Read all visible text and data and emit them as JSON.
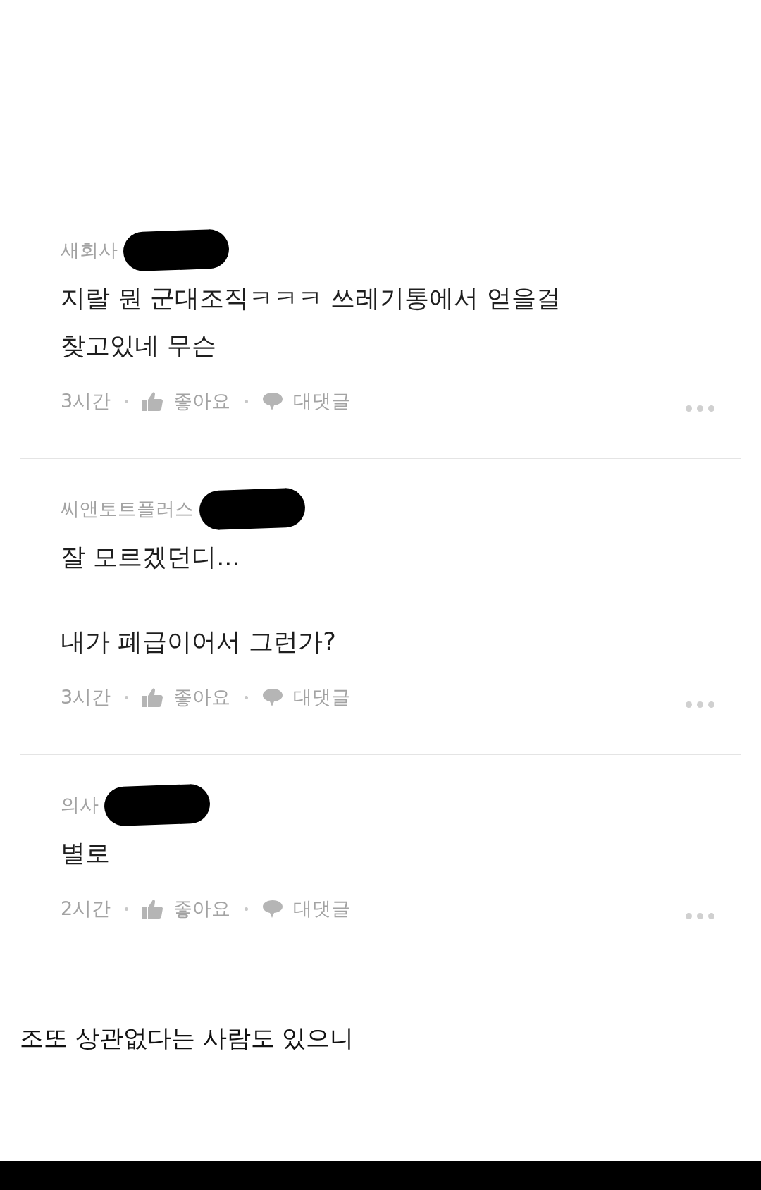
{
  "comments": [
    {
      "author": "새회사",
      "redacted": true,
      "paragraphs": [
        "지랄 뭔 군대조직ㅋㅋㅋ 쓰레기통에서 얻을걸 찾고있네 무슨"
      ],
      "time": "3시간",
      "like_label": "좋아요",
      "reply_label": "대댓글"
    },
    {
      "author": "씨앤토트플러스",
      "redacted": true,
      "paragraphs": [
        "잘 모르겠던디...",
        "내가 폐급이어서 그런가?"
      ],
      "time": "3시간",
      "like_label": "좋아요",
      "reply_label": "대댓글"
    },
    {
      "author": "의사",
      "redacted": true,
      "paragraphs": [
        "별로"
      ],
      "time": "2시간",
      "like_label": "좋아요",
      "reply_label": "대댓글"
    }
  ],
  "caption": "조또 상관없다는 사람도 있으니"
}
